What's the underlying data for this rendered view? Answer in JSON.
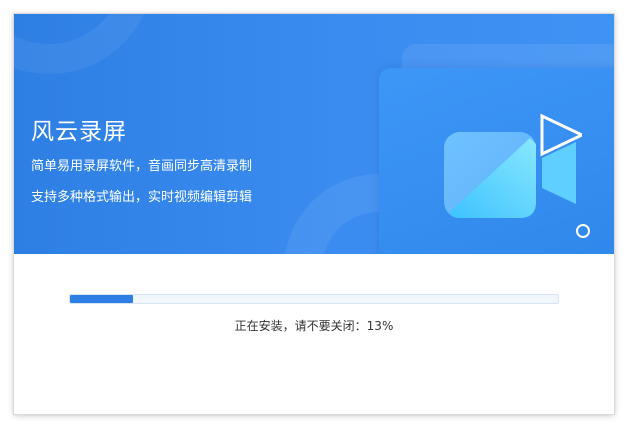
{
  "installer": {
    "app_name": "风云录屏",
    "taglines": [
      "简单易用录屏软件，音画同步高清录制",
      "支持多种格式输出，实时视频编辑剪辑"
    ],
    "progress": {
      "fraction": 0.13,
      "status_prefix": "正在安装，请不要关闭：",
      "percent_text": "13%"
    }
  },
  "icons": {
    "hero": "video-camera-icon",
    "play": "play-triangle-icon",
    "ring": "small-ring-icon"
  },
  "colors": {
    "banner": "#2e7fe4",
    "accent": "#2e7fe4",
    "camera_light": "#5ad8ff",
    "track": "#f1f6fd"
  }
}
